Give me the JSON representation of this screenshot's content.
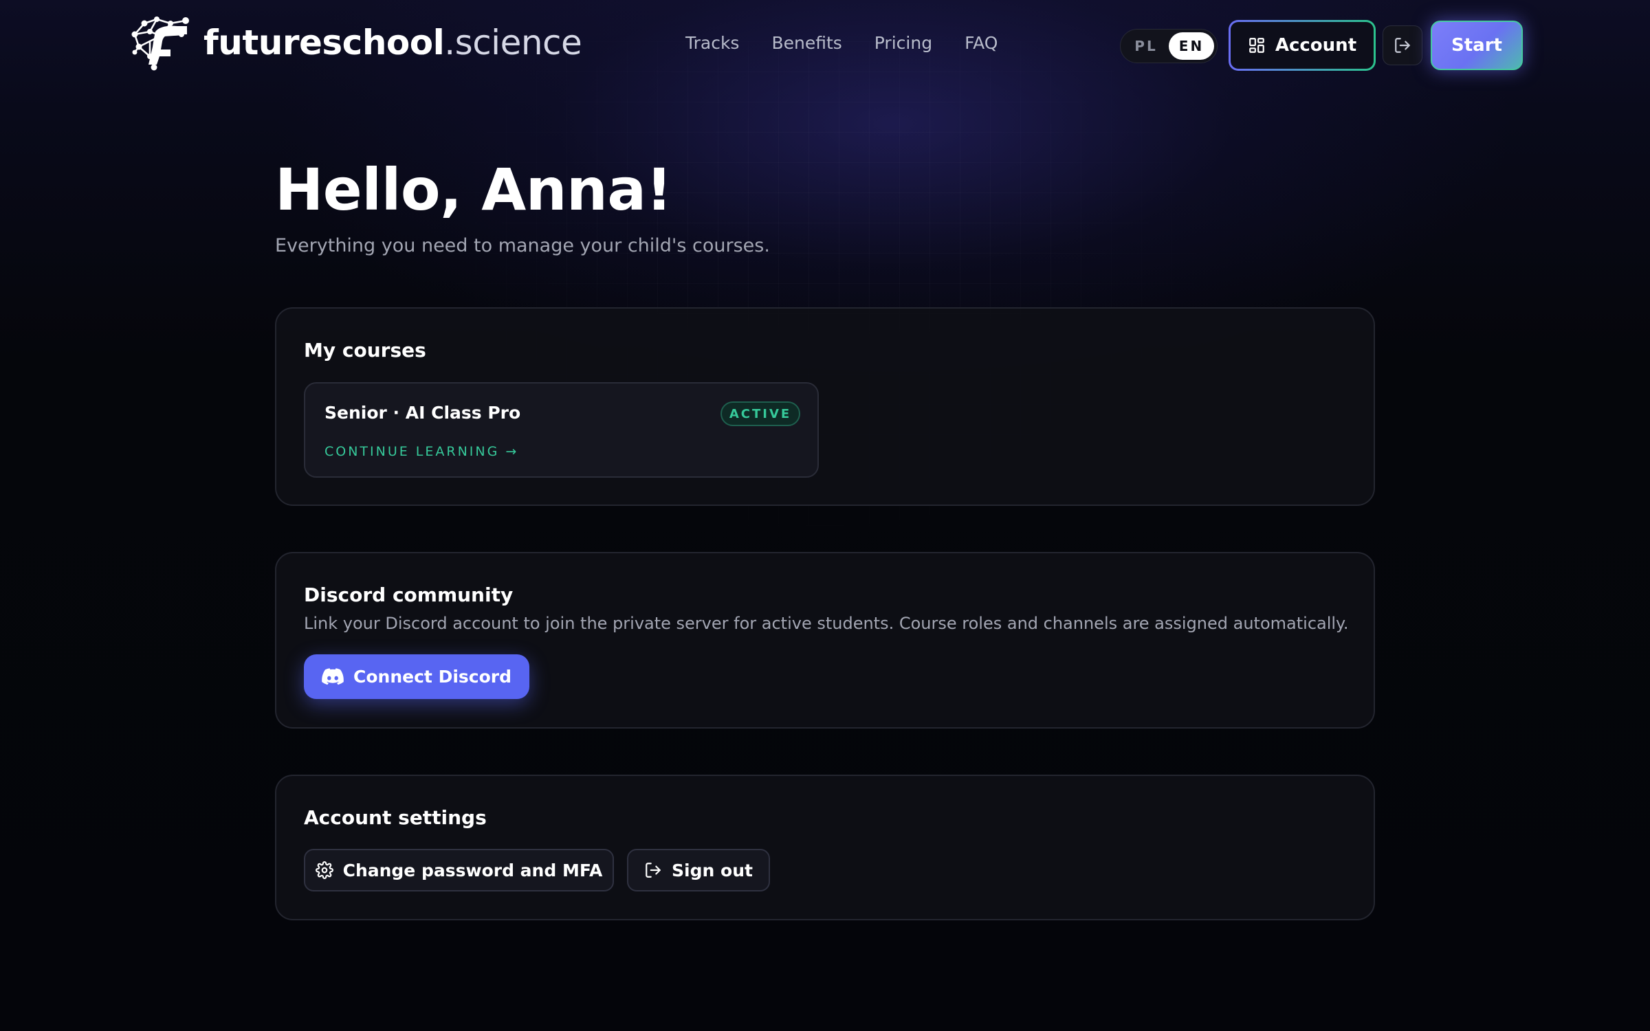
{
  "brand": {
    "name_bold": "futureschool",
    "name_light": ".science"
  },
  "nav": {
    "items": [
      "Tracks",
      "Benefits",
      "Pricing",
      "FAQ"
    ]
  },
  "language": {
    "options": [
      "PL",
      "EN"
    ],
    "selected": "EN"
  },
  "header_actions": {
    "account_label": "Account",
    "start_label": "Start"
  },
  "greeting": {
    "title": "Hello, Anna!",
    "subtitle": "Everything you need to manage your child's courses."
  },
  "courses": {
    "title": "My courses",
    "items": [
      {
        "name": "Senior · AI Class Pro",
        "status": "ACTIVE",
        "action": "CONTINUE LEARNING →"
      }
    ]
  },
  "discord": {
    "title": "Discord community",
    "description": "Link your Discord account to join the private server for active students. Course roles and channels are assigned automatically.",
    "button_label": "Connect Discord",
    "color": "#5865f2"
  },
  "settings": {
    "title": "Account settings",
    "change_password_label": "Change password and MFA",
    "sign_out_label": "Sign out"
  },
  "colors": {
    "accent": "#6a6df5",
    "success": "#36c99a",
    "background": "#05060b"
  }
}
